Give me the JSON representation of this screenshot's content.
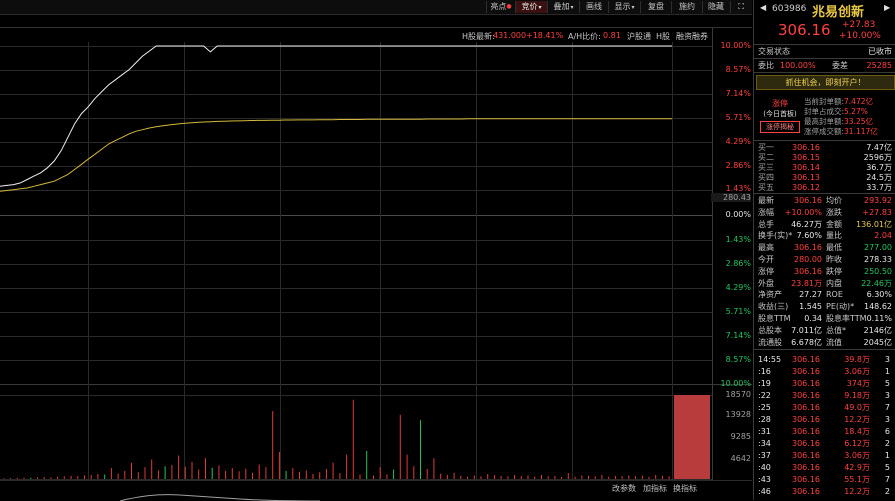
{
  "toolbar": {
    "items": [
      {
        "label": "亮点",
        "dot": "●",
        "caret": ""
      },
      {
        "label": "竞价",
        "dot": "",
        "caret": "▾"
      },
      {
        "label": "叠加",
        "dot": "",
        "caret": "▾"
      },
      {
        "label": "画线",
        "dot": "",
        "caret": ""
      },
      {
        "label": "显示",
        "dot": "",
        "caret": "▾"
      },
      {
        "label": "复盘",
        "dot": "",
        "caret": ""
      },
      {
        "label": "施约",
        "dot": "",
        "caret": ""
      },
      {
        "label": "隐藏",
        "dot": "",
        "caret": ""
      }
    ],
    "expand_icon": "⛶"
  },
  "info_row": {
    "h_latest_label": "H股最新:",
    "h_latest_value": "431.000",
    "h_latest_change": "+18.41%",
    "ah_ratio_label": "A/H比价:",
    "ah_ratio_value": "0.81",
    "hk_connect": "沪股通",
    "h_share": "H股",
    "margin": "融资融券"
  },
  "price_axis": {
    "upper_pct": [
      "10.00%",
      "8.57%",
      "7.14%",
      "5.71%",
      "4.29%",
      "2.86%",
      "1.43%"
    ],
    "pre_close": "280.43",
    "zero": "0.00%",
    "lower_pct": [
      "1.43%",
      "2.86%",
      "4.29%",
      "5.71%",
      "7.14%",
      "8.57%",
      "10.00%"
    ]
  },
  "volume_axis": {
    "labels": [
      "18570",
      "13928",
      "9285",
      "4642"
    ]
  },
  "bottom_tabs": [
    "改参数",
    "加指标",
    "换指标"
  ],
  "chart_data": {
    "type": "line",
    "series": [],
    "price_line_pct": [
      1.7,
      1.75,
      1.8,
      1.9,
      2.1,
      2.3,
      2.5,
      2.8,
      3.2,
      3.8,
      4.6,
      5.4,
      6.0,
      6.4,
      6.9,
      7.3,
      7.7,
      8.0,
      8.3,
      8.6,
      9.0,
      9.4,
      9.7,
      10.0,
      10.0,
      10.0,
      10.0,
      10.0,
      10.0,
      10.0,
      10.0,
      9.65,
      10.0,
      10.0,
      10.0,
      10.0,
      10.0,
      10.0,
      10.0,
      10.0,
      10.0,
      10.0,
      10.0,
      10.0,
      10.0,
      10.0,
      10.0,
      10.0,
      10.0,
      10.0,
      10.0,
      10.0,
      10.0,
      10.0,
      10.0,
      10.0,
      10.0,
      10.0,
      10.0,
      10.0,
      10.0,
      10.0,
      10.0,
      10.0,
      10.0,
      10.0,
      10.0,
      10.0,
      10.0,
      10.0,
      10.0,
      10.0,
      10.0,
      10.0,
      10.0,
      10.0,
      10.0,
      10.0,
      10.0,
      10.0,
      10.0,
      10.0,
      10.0,
      10.0,
      10.0,
      10.0,
      10.0,
      10.0,
      10.0,
      10.0,
      10.0,
      10.0,
      10.0,
      10.0,
      10.0,
      10.0,
      10.0,
      10.0,
      10.0,
      10.0
    ],
    "avg_line_pct": [
      1.4,
      1.45,
      1.5,
      1.55,
      1.6,
      1.7,
      1.8,
      1.9,
      2.0,
      2.2,
      2.4,
      2.7,
      3.0,
      3.3,
      3.6,
      3.9,
      4.2,
      4.4,
      4.6,
      4.8,
      4.95,
      5.05,
      5.15,
      5.22,
      5.28,
      5.33,
      5.38,
      5.42,
      5.45,
      5.48,
      5.5,
      5.52,
      5.54,
      5.55,
      5.56,
      5.57,
      5.58,
      5.59,
      5.6,
      5.6,
      5.61,
      5.61,
      5.62,
      5.62,
      5.63,
      5.63,
      5.63,
      5.64,
      5.64,
      5.64,
      5.65,
      5.65,
      5.65,
      5.65,
      5.66,
      5.66,
      5.66,
      5.66,
      5.67,
      5.67,
      5.67,
      5.67,
      5.67,
      5.68,
      5.68,
      5.68,
      5.68,
      5.68,
      5.68,
      5.69,
      5.69,
      5.69,
      5.69,
      5.69,
      5.69,
      5.69,
      5.7,
      5.7,
      5.7,
      5.7,
      5.7,
      5.7,
      5.7,
      5.7,
      5.7,
      5.7,
      5.7,
      5.7,
      5.7,
      5.7,
      5.7,
      5.7,
      5.7,
      5.7,
      5.7,
      5.7,
      5.7,
      5.7,
      5.7,
      5.7
    ],
    "ylim_pct": [
      0,
      10
    ],
    "volume_ylim": [
      0,
      18570
    ],
    "volume_bars": [
      {
        "v": 150,
        "c": "r"
      },
      {
        "v": 200,
        "c": "r"
      },
      {
        "v": 260,
        "c": "r"
      },
      {
        "v": 300,
        "c": "r"
      },
      {
        "v": 280,
        "c": "g"
      },
      {
        "v": 350,
        "c": "r"
      },
      {
        "v": 420,
        "c": "r"
      },
      {
        "v": 300,
        "c": "r"
      },
      {
        "v": 500,
        "c": "r"
      },
      {
        "v": 600,
        "c": "r"
      },
      {
        "v": 700,
        "c": "r"
      },
      {
        "v": 650,
        "c": "r"
      },
      {
        "v": 800,
        "c": "r"
      },
      {
        "v": 900,
        "c": "r"
      },
      {
        "v": 1100,
        "c": "r"
      },
      {
        "v": 1000,
        "c": "g"
      },
      {
        "v": 2400,
        "c": "r"
      },
      {
        "v": 1200,
        "c": "r"
      },
      {
        "v": 1800,
        "c": "r"
      },
      {
        "v": 3600,
        "c": "r"
      },
      {
        "v": 1500,
        "c": "r"
      },
      {
        "v": 2600,
        "c": "r"
      },
      {
        "v": 4300,
        "c": "r"
      },
      {
        "v": 1900,
        "c": "r"
      },
      {
        "v": 2800,
        "c": "g"
      },
      {
        "v": 3100,
        "c": "r"
      },
      {
        "v": 5200,
        "c": "r"
      },
      {
        "v": 2700,
        "c": "r"
      },
      {
        "v": 3800,
        "c": "r"
      },
      {
        "v": 2100,
        "c": "r"
      },
      {
        "v": 4600,
        "c": "r"
      },
      {
        "v": 2500,
        "c": "g"
      },
      {
        "v": 3000,
        "c": "r"
      },
      {
        "v": 1800,
        "c": "r"
      },
      {
        "v": 2400,
        "c": "r"
      },
      {
        "v": 1700,
        "c": "r"
      },
      {
        "v": 2300,
        "c": "r"
      },
      {
        "v": 1400,
        "c": "r"
      },
      {
        "v": 3200,
        "c": "r"
      },
      {
        "v": 2600,
        "c": "r"
      },
      {
        "v": 15000,
        "c": "r"
      },
      {
        "v": 6000,
        "c": "r"
      },
      {
        "v": 1800,
        "c": "g"
      },
      {
        "v": 2400,
        "c": "r"
      },
      {
        "v": 1600,
        "c": "r"
      },
      {
        "v": 1900,
        "c": "r"
      },
      {
        "v": 1100,
        "c": "r"
      },
      {
        "v": 1500,
        "c": "r"
      },
      {
        "v": 2200,
        "c": "r"
      },
      {
        "v": 3600,
        "c": "r"
      },
      {
        "v": 1300,
        "c": "r"
      },
      {
        "v": 5400,
        "c": "r"
      },
      {
        "v": 17500,
        "c": "r"
      },
      {
        "v": 1000,
        "c": "r"
      },
      {
        "v": 6200,
        "c": "g"
      },
      {
        "v": 800,
        "c": "r"
      },
      {
        "v": 2600,
        "c": "r"
      },
      {
        "v": 1000,
        "c": "r"
      },
      {
        "v": 2100,
        "c": "g"
      },
      {
        "v": 14200,
        "c": "r"
      },
      {
        "v": 5400,
        "c": "r"
      },
      {
        "v": 2800,
        "c": "r"
      },
      {
        "v": 13000,
        "c": "g"
      },
      {
        "v": 2200,
        "c": "r"
      },
      {
        "v": 4600,
        "c": "r"
      },
      {
        "v": 1200,
        "c": "r"
      },
      {
        "v": 900,
        "c": "r"
      },
      {
        "v": 1400,
        "c": "r"
      },
      {
        "v": 700,
        "c": "r"
      },
      {
        "v": 500,
        "c": "r"
      },
      {
        "v": 800,
        "c": "r"
      },
      {
        "v": 600,
        "c": "r"
      },
      {
        "v": 1100,
        "c": "r"
      },
      {
        "v": 900,
        "c": "r"
      },
      {
        "v": 700,
        "c": "r"
      },
      {
        "v": 600,
        "c": "r"
      },
      {
        "v": 900,
        "c": "r"
      },
      {
        "v": 650,
        "c": "r"
      },
      {
        "v": 800,
        "c": "r"
      },
      {
        "v": 500,
        "c": "r"
      },
      {
        "v": 900,
        "c": "r"
      },
      {
        "v": 600,
        "c": "r"
      },
      {
        "v": 700,
        "c": "r"
      },
      {
        "v": 450,
        "c": "r"
      },
      {
        "v": 1300,
        "c": "r"
      },
      {
        "v": 500,
        "c": "r"
      },
      {
        "v": 800,
        "c": "r"
      },
      {
        "v": 700,
        "c": "r"
      },
      {
        "v": 600,
        "c": "r"
      },
      {
        "v": 900,
        "c": "r"
      },
      {
        "v": 500,
        "c": "r"
      },
      {
        "v": 700,
        "c": "r"
      },
      {
        "v": 650,
        "c": "r"
      },
      {
        "v": 800,
        "c": "r"
      },
      {
        "v": 600,
        "c": "r"
      },
      {
        "v": 750,
        "c": "r"
      },
      {
        "v": 500,
        "c": "r"
      },
      {
        "v": 900,
        "c": "r"
      },
      {
        "v": 700,
        "c": "r"
      },
      {
        "v": 600,
        "c": "r"
      }
    ],
    "closing_auction_volume": 18570
  },
  "panel": {
    "code": "603986",
    "name": "兆易创新",
    "price": "306.16",
    "change": "+27.83",
    "change_pct": "+10.00%",
    "trade_status_label": "交易状态",
    "trade_status": "已收市",
    "weibi_label": "委比",
    "weibi_value": "100.00%",
    "weicha_label": "委差",
    "weicha_value": "25285",
    "banner": "抓住机会，即刻开户！",
    "limit_up_title": "涨停",
    "limit_up_sub": "(今日首板)",
    "limit_up_reveal": "涨停揭秘",
    "limit_up_stats": [
      {
        "label": "当前封单额:",
        "value": "7.472亿"
      },
      {
        "label": "封单占成交:",
        "value": "5.27%"
      },
      {
        "label": "最高封单额:",
        "value": "33.25亿"
      },
      {
        "label": "涨停成交额:",
        "value": "31.117亿"
      }
    ],
    "bids": [
      {
        "label": "买一",
        "price": "306.16",
        "vol": "7.47亿"
      },
      {
        "label": "买二",
        "price": "306.15",
        "vol": "2596万"
      },
      {
        "label": "买三",
        "price": "306.14",
        "vol": "36.7万"
      },
      {
        "label": "买四",
        "price": "306.13",
        "vol": "24.5万"
      },
      {
        "label": "买五",
        "price": "306.12",
        "vol": "33.7万"
      }
    ],
    "stats": [
      {
        "l1": "最新",
        "v1": "306.16",
        "c1": "red",
        "l2": "均价",
        "v2": "293.92",
        "c2": "red"
      },
      {
        "l1": "涨幅",
        "v1": "+10.00%",
        "c1": "red",
        "l2": "涨跌",
        "v2": "+27.83",
        "c2": "red"
      },
      {
        "l1": "总手",
        "v1": "46.27万",
        "c1": "white",
        "l2": "金额",
        "v2": "136.01亿",
        "c2": "yellow"
      },
      {
        "l1": "换手(实)*",
        "v1": "7.60%",
        "c1": "white",
        "l2": "量比",
        "v2": "2.04",
        "c2": "red"
      },
      {
        "l1": "最高",
        "v1": "306.16",
        "c1": "red",
        "l2": "最低",
        "v2": "277.00",
        "c2": "green"
      },
      {
        "l1": "今开",
        "v1": "280.00",
        "c1": "red",
        "l2": "昨收",
        "v2": "278.33",
        "c2": "white"
      },
      {
        "l1": "涨停",
        "v1": "306.16",
        "c1": "red",
        "l2": "跌停",
        "v2": "250.50",
        "c2": "green"
      },
      {
        "l1": "外盘",
        "v1": "23.81万",
        "c1": "red",
        "l2": "内盘",
        "v2": "22.46万",
        "c2": "green"
      },
      {
        "l1": "净资产",
        "v1": "27.27",
        "c1": "white",
        "l2": "ROE",
        "v2": "6.30%",
        "c2": "white"
      },
      {
        "l1": "收益(三)",
        "v1": "1.545",
        "c1": "white",
        "l2": "PE(动)*",
        "v2": "148.62",
        "c2": "white"
      },
      {
        "l1": "股息TTM",
        "v1": "0.34",
        "c1": "white",
        "l2": "股息率TTM",
        "v2": "0.11%",
        "c2": "white"
      },
      {
        "l1": "总股本",
        "v1": "7.011亿",
        "c1": "white",
        "l2": "总值*",
        "v2": "2146亿",
        "c2": "white"
      },
      {
        "l1": "流通股",
        "v1": "6.678亿",
        "c1": "white",
        "l2": "流值",
        "v2": "2045亿",
        "c2": "white"
      }
    ],
    "ticks": [
      {
        "t": "14:55",
        "p": "306.16",
        "v": "39.8万",
        "n": "3"
      },
      {
        "t": ":16",
        "p": "306.16",
        "v": "3.06万",
        "n": "1"
      },
      {
        "t": ":19",
        "p": "306.16",
        "v": "374万",
        "n": "5"
      },
      {
        "t": ":22",
        "p": "306.16",
        "v": "9.18万",
        "n": "3"
      },
      {
        "t": ":25",
        "p": "306.16",
        "v": "49.0万",
        "n": "7"
      },
      {
        "t": ":28",
        "p": "306.16",
        "v": "12.2万",
        "n": "3"
      },
      {
        "t": ":31",
        "p": "306.16",
        "v": "18.4万",
        "n": "6"
      },
      {
        "t": ":34",
        "p": "306.16",
        "v": "6.12万",
        "n": "2"
      },
      {
        "t": ":37",
        "p": "306.16",
        "v": "3.06万",
        "n": "1"
      },
      {
        "t": ":40",
        "p": "306.16",
        "v": "42.9万",
        "n": "5"
      },
      {
        "t": ":43",
        "p": "306.16",
        "v": "55.1万",
        "n": "7"
      },
      {
        "t": ":46",
        "p": "306.16",
        "v": "12.2万",
        "n": "2"
      }
    ]
  }
}
